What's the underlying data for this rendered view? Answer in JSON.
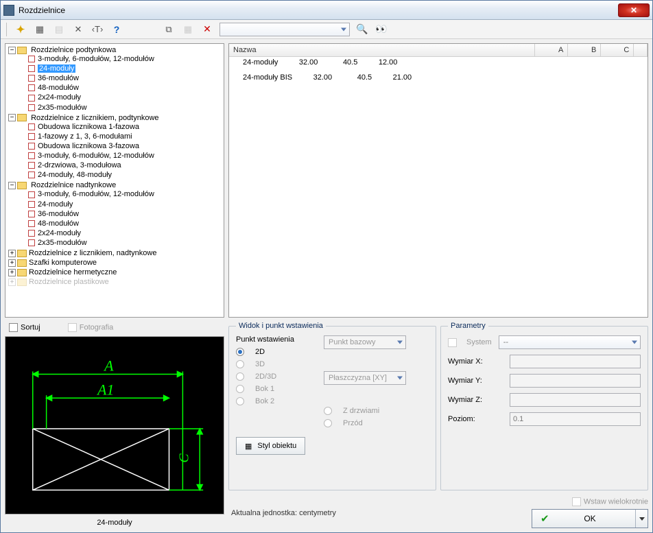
{
  "window": {
    "title": "Rozdzielnice"
  },
  "tree": {
    "node_podtynkowa": "Rozdzielnice podtynkowa",
    "podtynkowa_items": {
      "i0": "3-moduły, 6-modułów, 12-modułów",
      "i1": "24-moduły",
      "i2": "36-modułów",
      "i3": "48-modułów",
      "i4": "2x24-moduły",
      "i5": "2x35-modułów"
    },
    "node_licz_podt": "Rozdzielnice z licznikiem, podtynkowe",
    "licz_podt_items": {
      "i0": "Obudowa licznikowa 1-fazowa",
      "i1": "1-fazowy z 1, 3, 6-modułami",
      "i2": "Obudowa licznikowa 3-fazowa",
      "i3": "3-moduły, 6-modułów, 12-modułów",
      "i4": "2-drzwiowa, 3-modułowa",
      "i5": "24-moduły, 48-moduły"
    },
    "node_nadt": "Rozdzielnice nadtynkowe",
    "nadt_items": {
      "i0": "3-moduły, 6-modułów, 12-modułów",
      "i1": "24-moduły",
      "i2": "36-modułów",
      "i3": "48-modułów",
      "i4": "2x24-moduły",
      "i5": "2x35-modułów"
    },
    "node_licz_nadt": "Rozdzielnice z licznikiem, nadtynkowe",
    "node_szafki": "Szafki komputerowe",
    "node_herm": "Rozdzielnice hermetyczne",
    "node_plast": "Rozdzielnice plastikowe"
  },
  "table": {
    "cols": {
      "name": "Nazwa",
      "a": "A",
      "b": "B",
      "c": "C"
    },
    "rows": [
      {
        "name": "24-moduły",
        "a": "32.00",
        "b": "40.5",
        "c": "12.00"
      },
      {
        "name": "24-moduły BIS",
        "a": "32.00",
        "b": "40.5",
        "c": "21.00"
      }
    ]
  },
  "bottom_left": {
    "sortuj": "Sortuj",
    "fotografia": "Fotografia",
    "preview_caption": "24-moduły",
    "dim_a": "A",
    "dim_a1": "A1",
    "dim_c": "C"
  },
  "insert": {
    "legend": "Widok i punkt wstawienia",
    "punkt_label": "Punkt wstawienia",
    "punkt_value": "Punkt bazowy",
    "r2d": "2D",
    "r3d": "3D",
    "r3d_combo": "Płaszczyzna  [XY]",
    "r2d3d": "2D/3D",
    "rbok1": "Bok 1",
    "rbok2": "Bok 2",
    "rzdrz": "Z drzwiami",
    "rprzod": "Przód",
    "styl_btn": "Styl obiektu"
  },
  "params": {
    "legend": "Parametry",
    "system": "System",
    "system_val": "--",
    "wx": "Wymiar X:",
    "wy": "Wymiar Y:",
    "wz": "Wymiar Z:",
    "poziom": "Poziom:",
    "poziom_val": "0.1"
  },
  "footer": {
    "unit": "Aktualna jednostka: centymetry",
    "wstaw_w": "Wstaw wielokrotnie",
    "ok": "OK"
  }
}
